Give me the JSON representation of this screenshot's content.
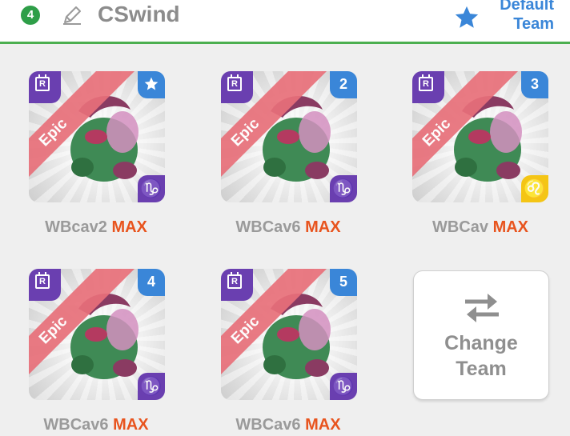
{
  "header": {
    "team_number": "4",
    "team_name": "CSwind",
    "default_line1": "Default",
    "default_line2": "Team",
    "accent_color": "#4caf50",
    "star_color": "#3a86d8"
  },
  "cards": [
    {
      "name": "WBcav2",
      "level": "MAX",
      "rarity": "Epic",
      "slot": "star",
      "sign": "♑",
      "sign_color": "purple"
    },
    {
      "name": "WBCav6",
      "level": "MAX",
      "rarity": "Epic",
      "slot": "2",
      "sign": "♑",
      "sign_color": "purple"
    },
    {
      "name": "WBCav",
      "level": "MAX",
      "rarity": "Epic",
      "slot": "3",
      "sign": "♌",
      "sign_color": "yellow"
    },
    {
      "name": "WBCav6",
      "level": "MAX",
      "rarity": "Epic",
      "slot": "4",
      "sign": "♑",
      "sign_color": "purple"
    },
    {
      "name": "WBCav6",
      "level": "MAX",
      "rarity": "Epic",
      "slot": "5",
      "sign": "♑",
      "sign_color": "purple"
    }
  ],
  "change_team": {
    "line1": "Change",
    "line2": "Team",
    "icon": "swap-arrows-icon"
  }
}
